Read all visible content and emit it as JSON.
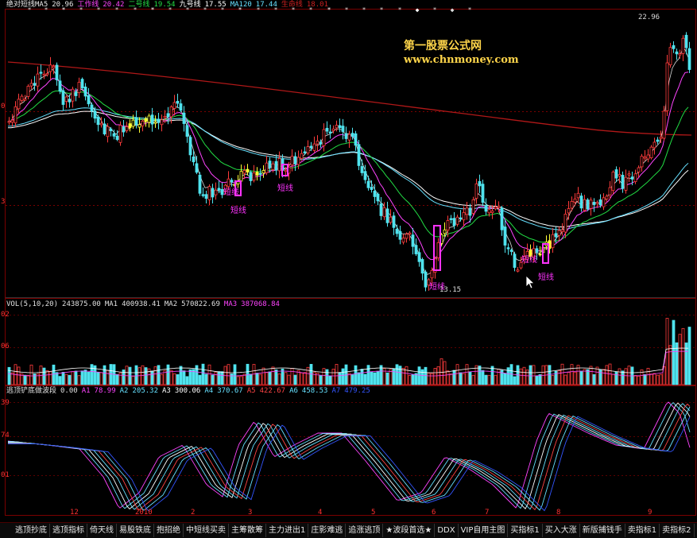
{
  "legend": {
    "price": [
      {
        "text": "绝对短线MA5",
        "color": "#e8e8e8"
      },
      {
        "text": "20.96",
        "color": "#e8e8e8"
      },
      {
        "text": "工作线",
        "color": "#ff44ff"
      },
      {
        "text": "20.42",
        "color": "#ff44ff"
      },
      {
        "text": "二号线",
        "color": "#22dd44"
      },
      {
        "text": "19.54",
        "color": "#22dd44"
      },
      {
        "text": "九号线",
        "color": "#ffffff"
      },
      {
        "text": "17.55",
        "color": "#ffffff"
      },
      {
        "text": "MA120",
        "color": "#66e0ff"
      },
      {
        "text": "17.44",
        "color": "#66e0ff"
      },
      {
        "text": "生命线",
        "color": "#cc2020"
      },
      {
        "text": "18.01",
        "color": "#cc2020"
      }
    ],
    "volume": [
      {
        "text": "VOL(5,10,20)",
        "color": "#e0e0e0"
      },
      {
        "text": "243875.00",
        "color": "#e0e0e0"
      },
      {
        "text": "MA1",
        "color": "#e0e0e0"
      },
      {
        "text": "400938.41",
        "color": "#e0e0e0"
      },
      {
        "text": "MA2",
        "color": "#e0e0e0"
      },
      {
        "text": "570822.69",
        "color": "#e0e0e0"
      },
      {
        "text": "MA3",
        "color": "#ff44ff"
      },
      {
        "text": "387068.84",
        "color": "#ff44ff"
      }
    ],
    "indicator": [
      {
        "text": "逃顶铲底做波段",
        "color": "#e0e0e0"
      },
      {
        "text": "0.00",
        "color": "#e0e0e0"
      },
      {
        "text": "A1",
        "color": "#ff44ff"
      },
      {
        "text": "78.99",
        "color": "#ff44ff"
      },
      {
        "text": "A2",
        "color": "#66e0ff"
      },
      {
        "text": "205.32",
        "color": "#66e0ff"
      },
      {
        "text": "A3",
        "color": "#ffffff"
      },
      {
        "text": "300.06",
        "color": "#ffffff"
      },
      {
        "text": "A4",
        "color": "#66e0ff"
      },
      {
        "text": "370.67",
        "color": "#66e0ff"
      },
      {
        "text": "A5",
        "color": "#ff4444"
      },
      {
        "text": "422.67",
        "color": "#ff4444"
      },
      {
        "text": "A6",
        "color": "#66e0ff"
      },
      {
        "text": "458.53",
        "color": "#66e0ff"
      },
      {
        "text": "A7",
        "color": "#3355ff"
      },
      {
        "text": "479.25",
        "color": "#3355ff"
      }
    ]
  },
  "watermark": {
    "line1": "第一股票公式网",
    "line2": "www.chnmoney.com"
  },
  "price_notes": {
    "high": "22.96",
    "low": "13.15"
  },
  "y_labels": {
    "price_a": "0",
    "price_b": "3",
    "vol_a": "02",
    "vol_b": "06",
    "ind_a": "39",
    "ind_b": "74",
    "ind_c": "01"
  },
  "x_labels": [
    "12",
    "2010",
    "2",
    "3",
    "4",
    "5",
    "6",
    "7",
    "8",
    "9"
  ],
  "signal_label": "短线",
  "tabs": [
    "逃顶抄底",
    "逃顶指标",
    "倚天线",
    "易股铁底",
    "抱招绝",
    "中短线买卖",
    "主筹散筹",
    "主力进出1",
    "庄影难逃",
    "追涨逃顶",
    "★波段首选★",
    "DDX",
    "VIP自用主图",
    "买指标1",
    "买入大涨",
    "新版捕钱手",
    "卖指标1",
    "卖指标2"
  ],
  "colors": {
    "up": "#ff3b3b",
    "down": "#4fe3ee",
    "signal": "#ffff33",
    "box": "#ff33ff",
    "border": "#7a0000"
  }
}
